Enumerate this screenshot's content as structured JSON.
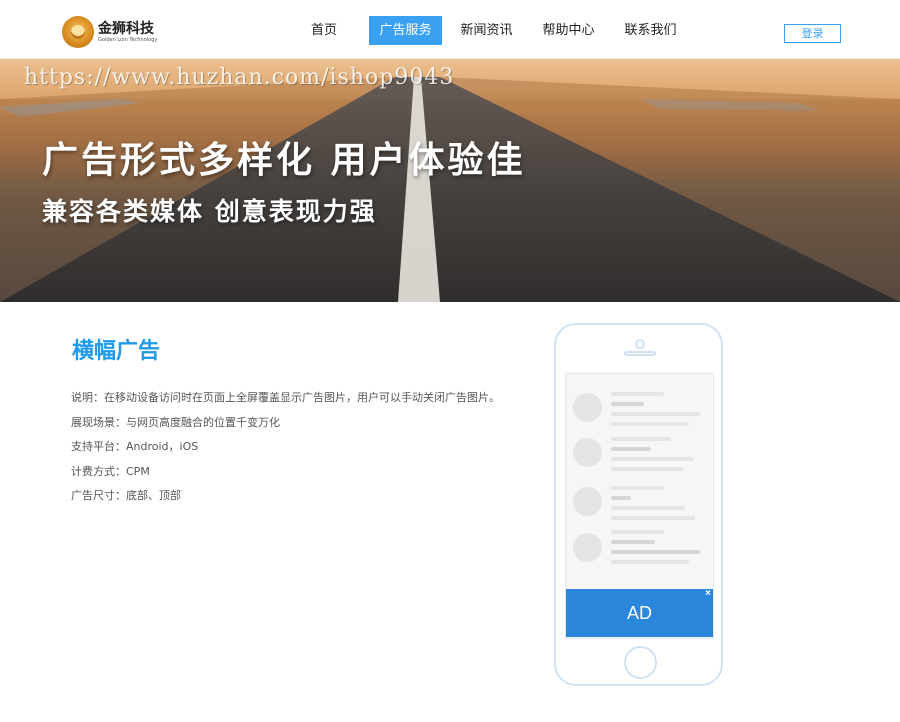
{
  "header": {
    "logo_name": "金狮科技",
    "logo_tagline": "Golden Lion Technology",
    "nav": [
      {
        "label": "首页"
      },
      {
        "label": "广告服务"
      },
      {
        "label": "新闻资讯"
      },
      {
        "label": "帮助中心"
      },
      {
        "label": "联系我们"
      }
    ],
    "active_nav": "广告服务",
    "login_label": "登录",
    "accent_color": "#3aa0f2"
  },
  "banner": {
    "watermark": "https://www.huzhan.com/ishop9043",
    "headline": "广告形式多样化  用户体验佳",
    "subline": "兼容各类媒体  创意表现力强"
  },
  "content": {
    "title": "横幅广告",
    "rows": [
      {
        "label": "说明：",
        "value": "在移动设备访问时在页面上全屏覆盖显示广告图片，用户可以手动关闭广告图片。"
      },
      {
        "label": "展现场景：",
        "value": "与网页高度融合的位置千变万化"
      },
      {
        "label": "支持平台：",
        "value": "Android，iOS"
      },
      {
        "label": "计费方式：",
        "value": "CPM"
      },
      {
        "label": "广告尺寸：",
        "value": "底部、顶部"
      }
    ]
  },
  "phone": {
    "ad_label": "AD",
    "ad_close": "×",
    "ad_color": "#2a87db",
    "feed_items": 4
  }
}
